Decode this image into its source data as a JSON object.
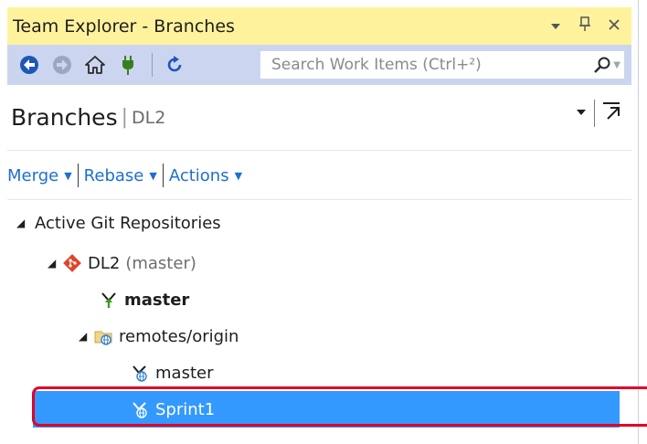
{
  "window": {
    "title": "Team Explorer - Branches",
    "controls": [
      "dropdown-icon",
      "pin-icon",
      "close-icon"
    ]
  },
  "toolbar": {
    "buttons": [
      "back-icon",
      "forward-icon",
      "home-icon",
      "connect-icon",
      "refresh-icon"
    ],
    "search_placeholder": "Search Work Items (Ctrl+²)"
  },
  "header": {
    "title": "Branches",
    "separator": "|",
    "repo": "DL2"
  },
  "actions": [
    {
      "label": "Merge"
    },
    {
      "label": "Rebase"
    },
    {
      "label": "Actions"
    }
  ],
  "tree": {
    "root_label": "Active Git Repositories",
    "repo_name": "DL2",
    "repo_branch": "(master)",
    "local_branch": "master",
    "remote_group": "remotes/origin",
    "remote_branches": [
      "master",
      "Sprint1"
    ],
    "selected": "Sprint1"
  },
  "colors": {
    "title_bar": "#fff29d",
    "toolbar": "#ccd5f0",
    "link": "#1e6fcf",
    "selection": "#3399ff",
    "highlight_box": "#e0002a"
  }
}
